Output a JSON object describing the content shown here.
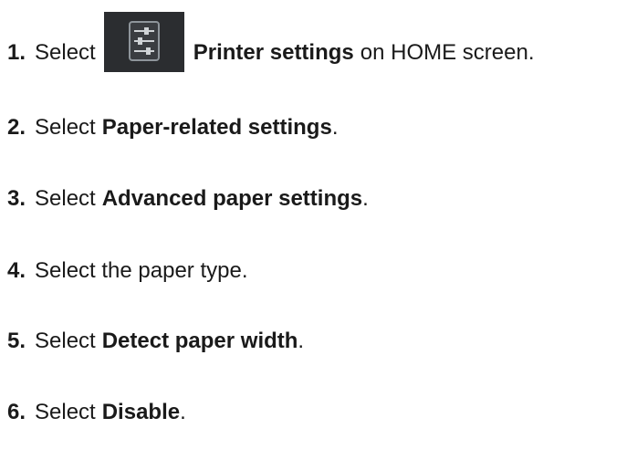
{
  "steps": [
    {
      "number": "1.",
      "parts": [
        "Select",
        "Printer settings",
        "on HOME screen."
      ],
      "icon": "printer-settings-sliders-icon"
    },
    {
      "number": "2.",
      "parts": [
        "Select",
        "Paper-related settings",
        "."
      ]
    },
    {
      "number": "3.",
      "parts": [
        "Select",
        "Advanced paper settings",
        "."
      ]
    },
    {
      "number": "4.",
      "parts": [
        "Select the paper type."
      ]
    },
    {
      "number": "5.",
      "parts": [
        "Select",
        "Detect paper width",
        "."
      ]
    },
    {
      "number": "6.",
      "parts": [
        "Select",
        "Disable",
        "."
      ]
    }
  ],
  "colors": {
    "text": "#1a1a1a",
    "icon_bg": "#2b2d30",
    "icon_fg": "#cfd3d6"
  }
}
